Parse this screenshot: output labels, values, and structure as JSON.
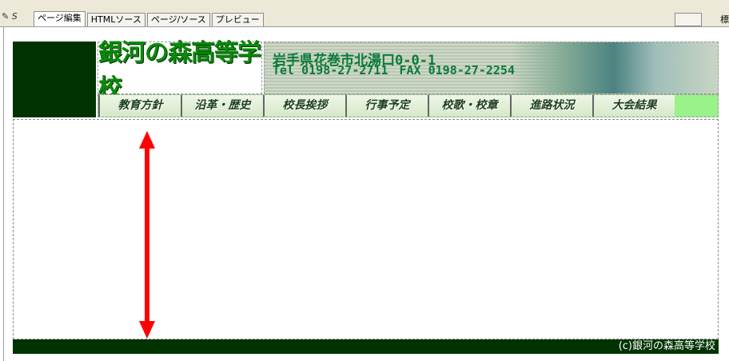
{
  "editor": {
    "tabs": [
      "ページ編集",
      "HTMLソース",
      "ページ/ソース",
      "プレビュー"
    ],
    "active_tab": 0,
    "right_label": "標"
  },
  "header": {
    "school_name": "銀河の森高等学校",
    "address": "岩手県花巻市北湯口0-0-1",
    "tel": "Tel 0198-27-2711",
    "fax": "FAX 0198-27-2254"
  },
  "nav": {
    "items": [
      "教育方針",
      "沿革・歴史",
      "校長挨拶",
      "行事予定",
      "校歌・校章",
      "進路状況",
      "大会結果"
    ]
  },
  "footer": {
    "copyright": "(c)銀河の森高等学校"
  },
  "colors": {
    "dark_green": "#003300",
    "menu_green": "#9af28a",
    "arrow_red": "#ff0000"
  }
}
